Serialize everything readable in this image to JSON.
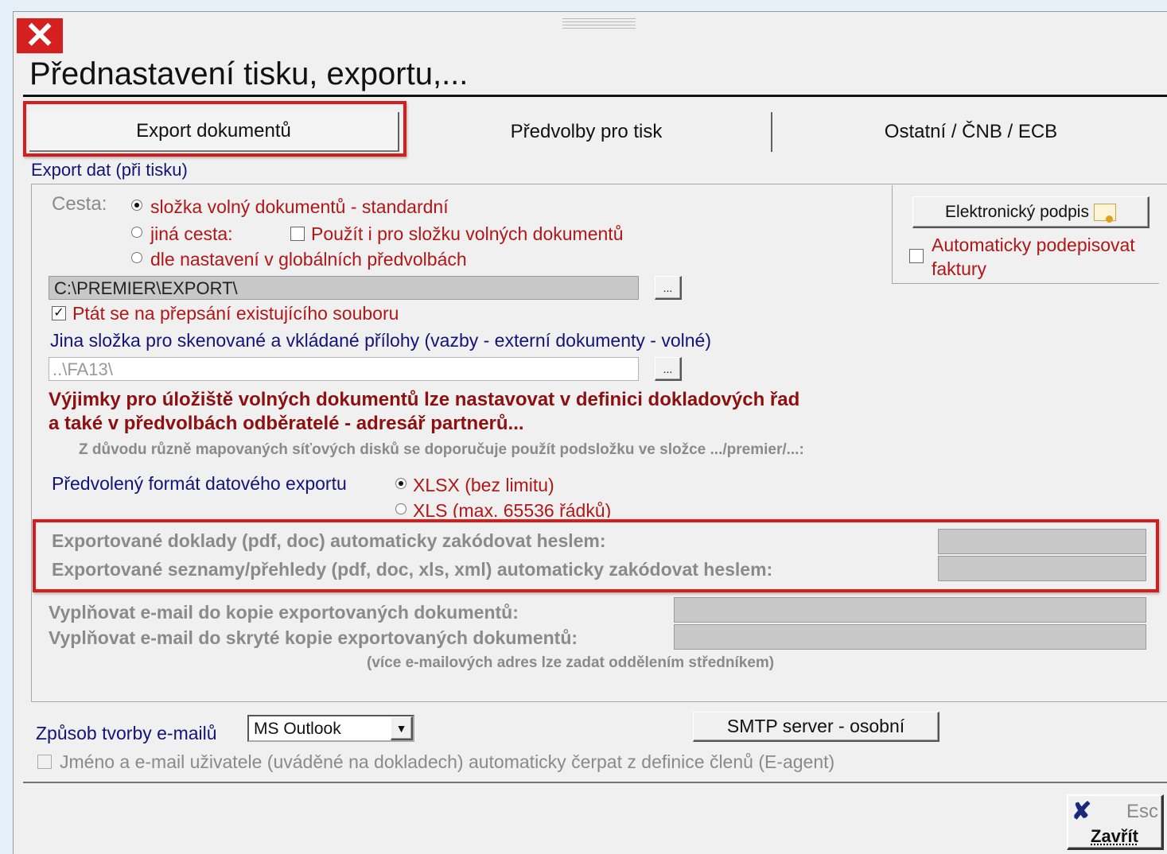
{
  "window": {
    "title": "Přednastavení tisku, exportu,..."
  },
  "tabs": [
    {
      "label": "Export dokumentů",
      "active": true
    },
    {
      "label": "Předvolby pro tisk",
      "active": false
    },
    {
      "label": "Ostatní / ČNB / ECB",
      "active": false
    }
  ],
  "export_section": {
    "label": "Export dat (při tisku)",
    "path_label": "Cesta:",
    "path_options": [
      {
        "label": "složka volný dokumentů - standardní",
        "selected": true
      },
      {
        "label": "jiná cesta:",
        "selected": false
      },
      {
        "label": "dle nastavení v globálních předvolbách",
        "selected": false
      }
    ],
    "use_for_free_docs": {
      "label": "Použít i pro složku volných dokumentů",
      "checked": false
    },
    "path_value": "C:\\PREMIER\\EXPORT\\",
    "browse_label": "...",
    "ask_overwrite": {
      "label": "Ptát se na přepsání existujícího souboru",
      "checked": true
    },
    "scan_folder_label": "Jina složka pro skenované a vkládané přílohy (vazby - externí dokumenty - volné)",
    "scan_folder_value": "..\\FA13\\",
    "note_line1": "Výjimky pro úložiště volných dokumentů lze nastavovat v definici dokladových řad",
    "note_line2": "a také v předvolbách odběratelé - adresář partnerů...",
    "note_small": "Z důvodu různě mapovaných síťových disků se doporučuje použít podsložku ve složce .../premier/...:",
    "format_label": "Předvolený formát datového exportu",
    "format_options": [
      {
        "label": "XLSX (bez limitu)",
        "selected": true
      },
      {
        "label": "XLS (max. 65536 řádků)",
        "selected": false
      }
    ],
    "encrypt_docs_label": "Exportované doklady (pdf, doc) automaticky zakódovat heslem:",
    "encrypt_lists_label": "Exportované seznamy/přehledy (pdf, doc, xls, xml) automaticky zakódovat heslem:",
    "cc_label": "Vyplňovat e-mail do kopie exportovaných dokumentů:",
    "bcc_label": "Vyplňovat e-mail do skryté kopie exportovaných dokumentů:",
    "email_hint": "(více e-mailových adres lze zadat oddělením středníkem)"
  },
  "signature": {
    "button_label": "Elektronický podpis",
    "auto_sign_line1": "Automaticky podepisovat",
    "auto_sign_line2": "faktury",
    "auto_sign_checked": false
  },
  "email": {
    "method_label": "Způsob tvorby e-mailů",
    "method_value": "MS Outlook",
    "smtp_button": "SMTP server - osobní",
    "name_from_agent": {
      "label": "Jméno a e-mail uživatele (uváděné na dokladech) automaticky čerpat z definice členů (E-agent)",
      "checked": false
    }
  },
  "footer": {
    "close_shortcut": "Esc",
    "close_label": "Zavřít"
  },
  "colors": {
    "highlight_red": "#d81c1c",
    "label_red": "#b01818",
    "label_navy": "#13137a",
    "disabled_gray": "#8a8a8a"
  }
}
